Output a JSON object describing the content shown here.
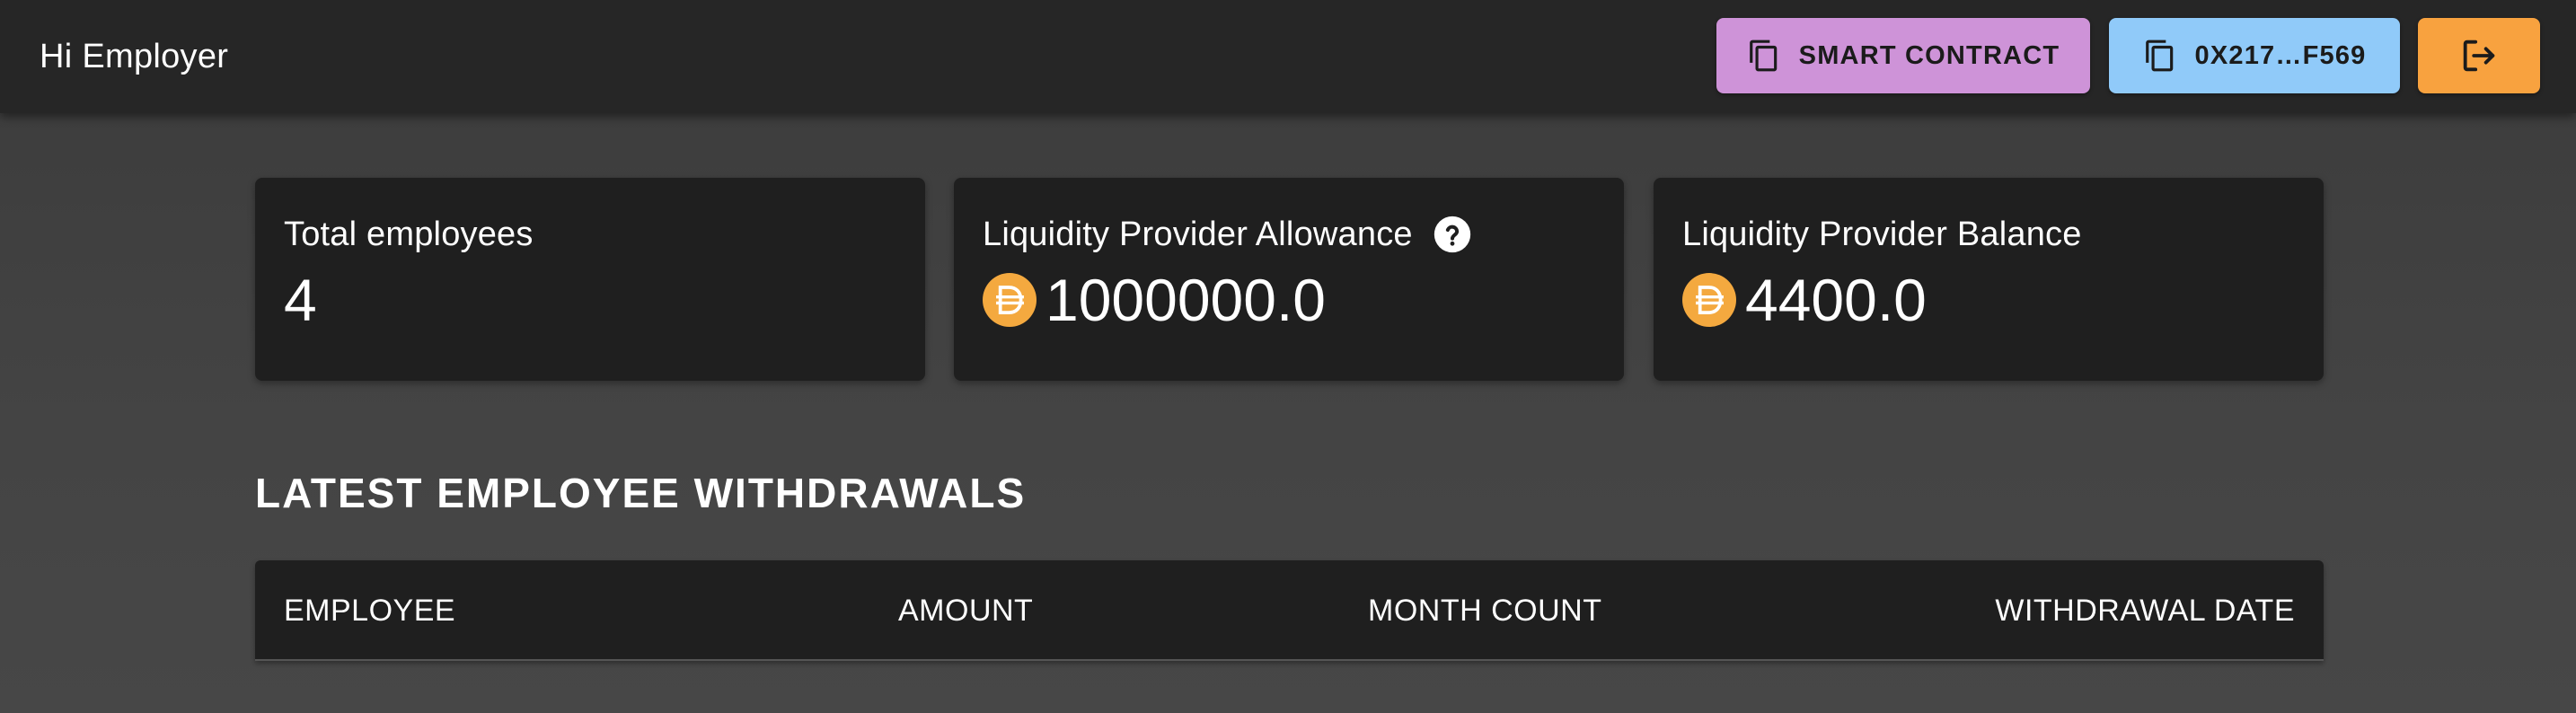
{
  "appbar": {
    "title": "Hi Employer",
    "buttons": {
      "smart_contract": {
        "label": "SMART CONTRACT",
        "icon": "copy-icon",
        "color": "#ce93d8"
      },
      "wallet": {
        "label": "0X217…F569",
        "icon": "copy-icon",
        "color": "#90caf9"
      },
      "logout": {
        "icon": "logout-icon",
        "color": "#f8a23f"
      }
    }
  },
  "stats": [
    {
      "label": "Total employees",
      "value": "4"
    },
    {
      "label": "Liquidity Provider Allowance",
      "value": "1000000.0",
      "icon": "dai-coin-icon",
      "help_icon": "help-icon"
    },
    {
      "label": "Liquidity Provider Balance",
      "value": "4400.0",
      "icon": "dai-coin-icon"
    }
  ],
  "withdrawals": {
    "title": "LATEST EMPLOYEE WITHDRAWALS",
    "columns": [
      "EMPLOYEE",
      "AMOUNT",
      "MONTH COUNT",
      "WITHDRAWAL DATE"
    ],
    "rows": []
  },
  "colors": {
    "background": "#444444",
    "surface": "#1f1f1f",
    "appbar": "#262626",
    "dai": "#f4a93f"
  }
}
